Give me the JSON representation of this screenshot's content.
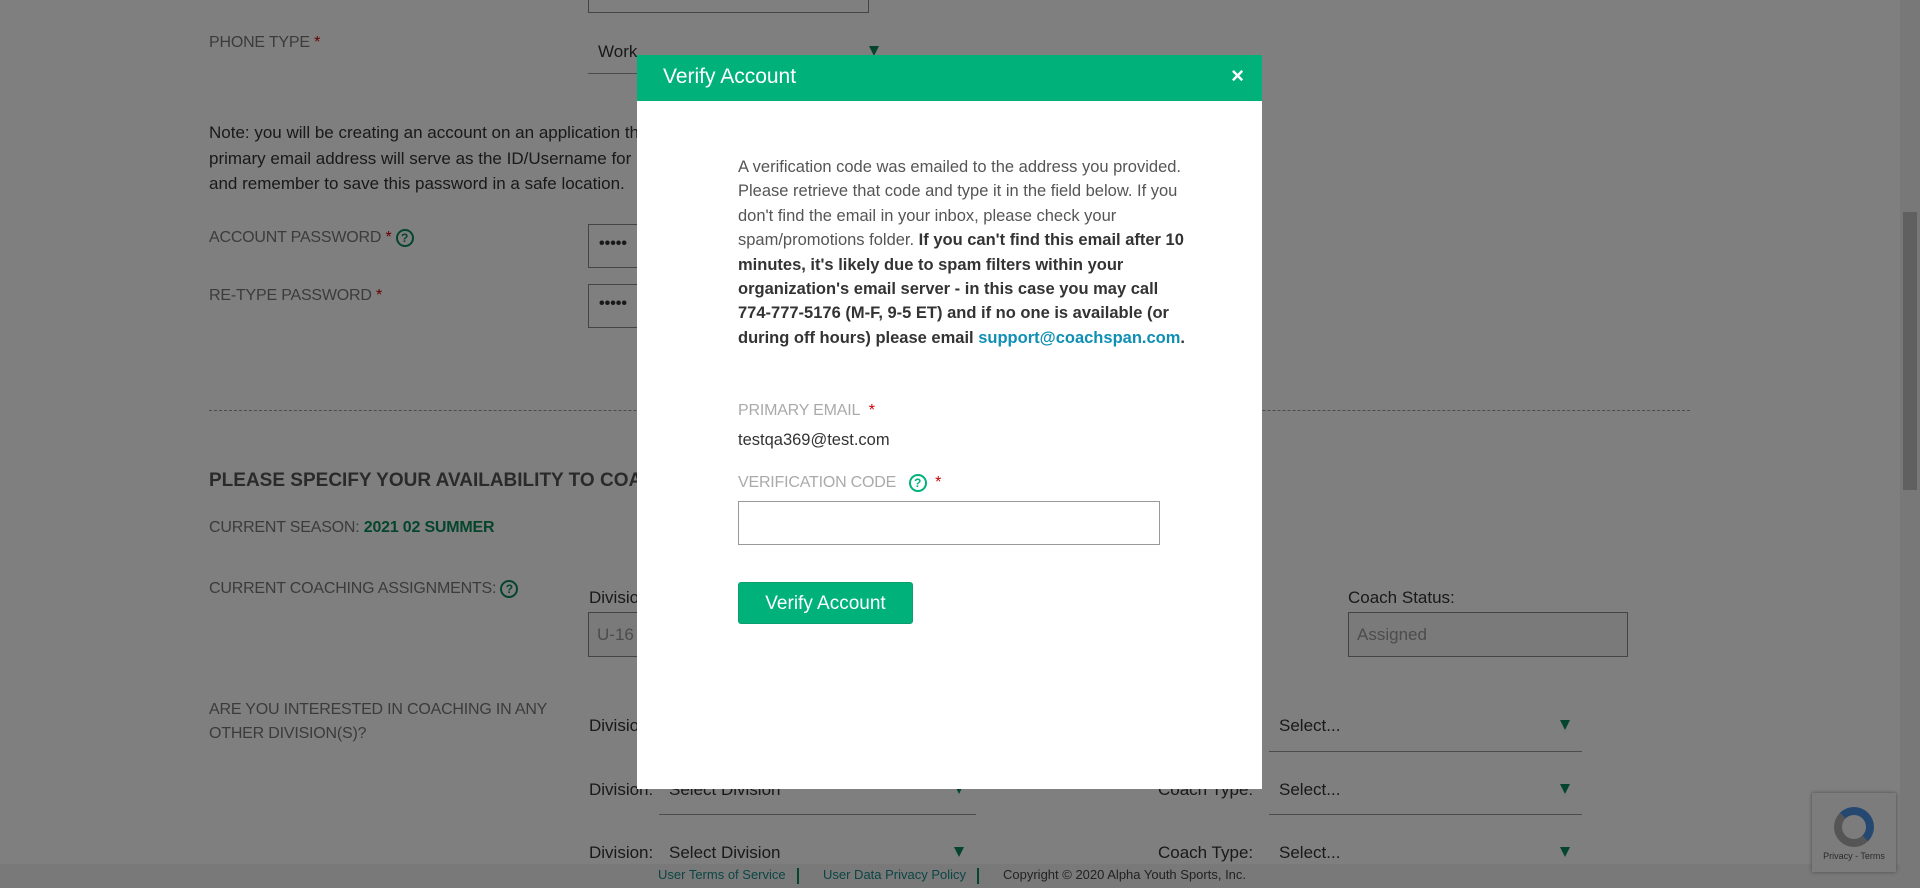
{
  "form": {
    "phone_type_label": "PHONE TYPE",
    "phone_type_value": "Work",
    "note_lines": [
      "Note: you will be creating an account on an application th",
      "primary email address will serve as the ID/Username for",
      "and remember to save this password in a safe location."
    ],
    "account_password_label": "ACCOUNT PASSWORD",
    "account_password_value": "•••••",
    "retype_password_label": "RE-TYPE PASSWORD",
    "retype_password_value": "•••••",
    "availability_heading": "PLEASE SPECIFY YOUR AVAILABILITY TO COA",
    "current_season_label": "CURRENT SEASON:",
    "current_season_value": "2021 02 SUMMER",
    "assignments_label": "CURRENT COACHING ASSIGNMENTS:",
    "division_label_cut": "Divisio",
    "division_value_cut": "U-16",
    "coach_status_label": "Coach Status:",
    "coach_status_value": "Assigned",
    "other_divisions_label_1": "ARE YOU INTERESTED IN COACHING IN ANY",
    "other_divisions_label_2": "OTHER DIVISION(S)?",
    "division_rows": [
      {
        "division_label": "Divisio",
        "division_value": "",
        "coach_type_label": "",
        "coach_type_value": "Select..."
      },
      {
        "division_label": "Division:",
        "division_value": "Select Division",
        "coach_type_label": "Coach Type:",
        "coach_type_value": "Select..."
      },
      {
        "division_label": "Division:",
        "division_value": "Select Division",
        "coach_type_label": "Coach Type:",
        "coach_type_value": "Select..."
      }
    ],
    "required_mark": "*",
    "help_glyph": "?"
  },
  "modal": {
    "title": "Verify Account",
    "close": "×",
    "intro": "A verification code was emailed to the address you provided. Please retrieve that code and type it in the field below. If you don't find the email in your inbox, please check your spam/promotions folder. ",
    "bold": "If you can't find this email after 10 minutes, it's likely due to spam filters within your organization's email server - in this case you may call 774-777-5176 (M-F, 9-5 ET) and if no one is available (or during off hours) please email ",
    "support_email": "support@coachspan.com",
    "period": ".",
    "primary_email_label": "PRIMARY EMAIL",
    "primary_email_value": "testqa369@test.com",
    "verification_code_label": "VERIFICATION CODE",
    "verification_code_value": "",
    "verify_button": "Verify Account"
  },
  "footer": {
    "terms": "User Terms of Service",
    "privacy": "User Data Privacy Policy",
    "copyright": "Copyright © 2020 Alpha Youth Sports, Inc."
  },
  "recaptcha": {
    "text": "Privacy - Terms"
  },
  "colors": {
    "accent": "#00b27a",
    "link": "#0f8fb3",
    "required": "#cc0000"
  }
}
